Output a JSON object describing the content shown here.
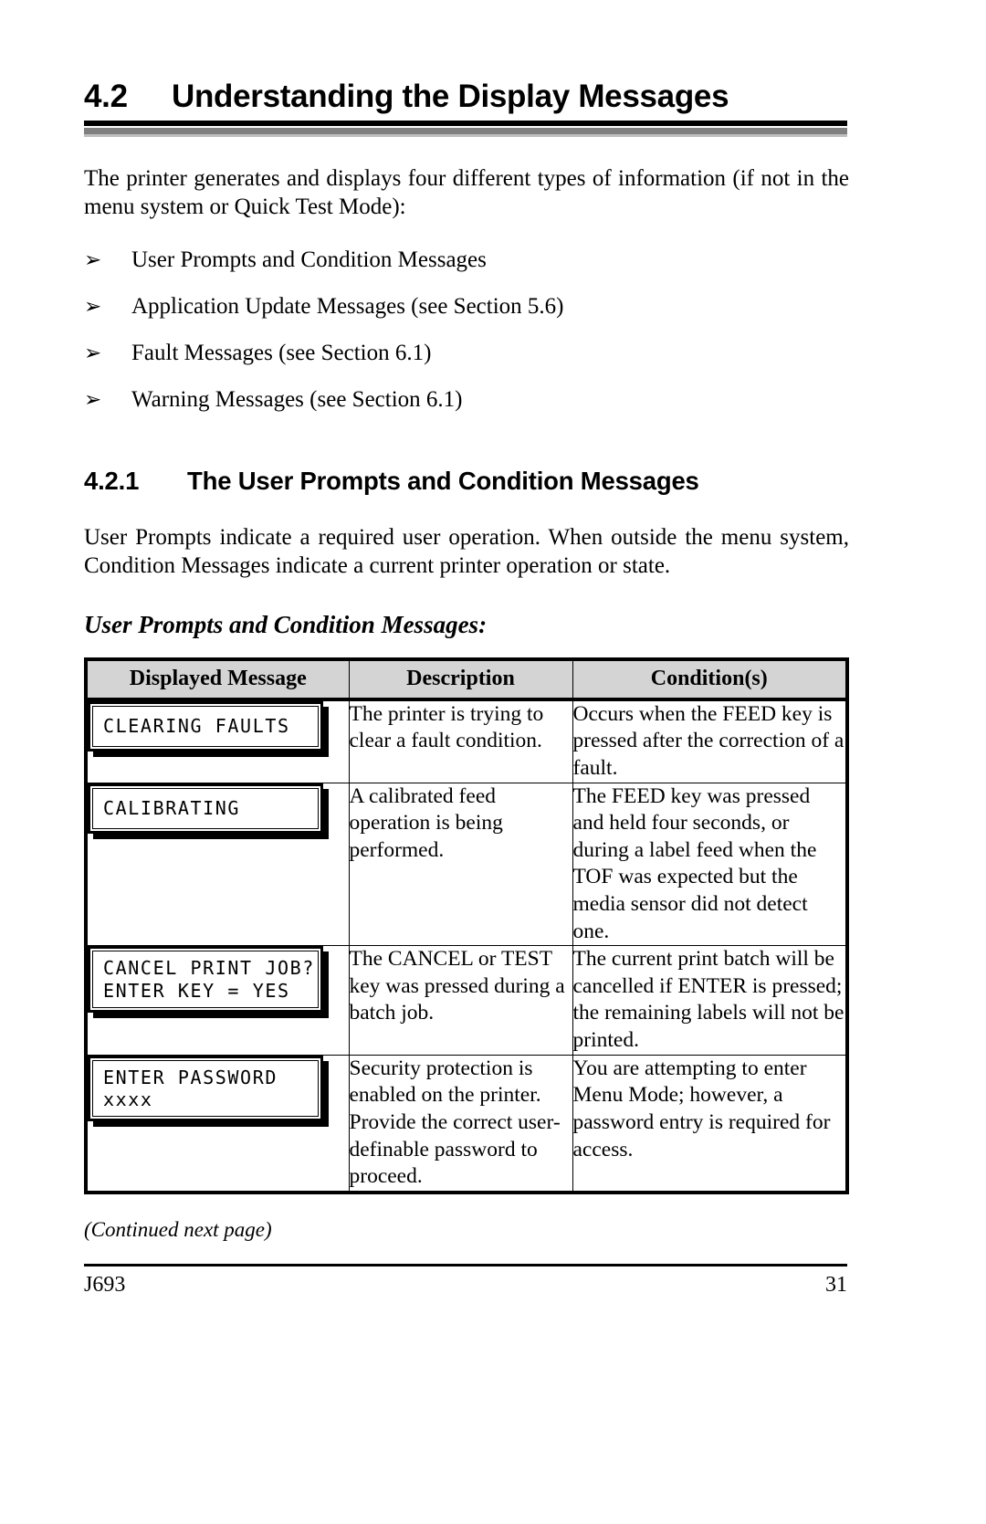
{
  "section": {
    "number": "4.2",
    "title": "Understanding the Display Messages"
  },
  "intro_paragraph": "The printer generates and displays four different types of information (if not in the menu system or Quick Test Mode):",
  "bullet_glyph": "➢",
  "bullets": [
    {
      "label": "User Prompts and Condition Messages"
    },
    {
      "label": "Application Update Messages (see Section 5.6)"
    },
    {
      "label": "Fault Messages (see Section 6.1)"
    },
    {
      "label": "Warning Messages (see Section 6.1)"
    }
  ],
  "subsection": {
    "number": "4.2.1",
    "title": "The User Prompts and Condition Messages"
  },
  "subsection_paragraph": "User Prompts indicate a required user operation. When outside the menu system, Condition Messages indicate a current printer operation or state.",
  "table_caption": "User Prompts and Condition Messages:",
  "table": {
    "headers": [
      "Displayed Message",
      "Description",
      "Condition(s)"
    ],
    "rows": [
      {
        "display_lines": [
          "CLEARING FAULTS"
        ],
        "description": "The printer is trying to clear a fault condition.",
        "conditions": "Occurs when the FEED key is pressed after the correction of a fault."
      },
      {
        "display_lines": [
          "CALIBRATING"
        ],
        "description": "A calibrated feed operation is being performed.",
        "conditions": "The FEED key was pressed and held four seconds, or during a label feed when the TOF was expected but the media sensor did not detect one."
      },
      {
        "display_lines": [
          "CANCEL PRINT JOB?",
          "ENTER KEY = YES"
        ],
        "description": "The CANCEL or TEST key was pressed during a batch job.",
        "conditions": "The current print batch will be cancelled if ENTER is pressed; the remaining labels will not be printed."
      },
      {
        "display_lines": [
          "ENTER PASSWORD",
          "xxxx"
        ],
        "description": "Security protection is enabled on the printer. Provide the correct user-definable password to proceed.",
        "conditions": "You are attempting to enter Menu Mode; however, a password entry is required for access."
      }
    ]
  },
  "continued_note": "(Continued next page)",
  "footer": {
    "document_id": "J693",
    "page_number": "31"
  }
}
